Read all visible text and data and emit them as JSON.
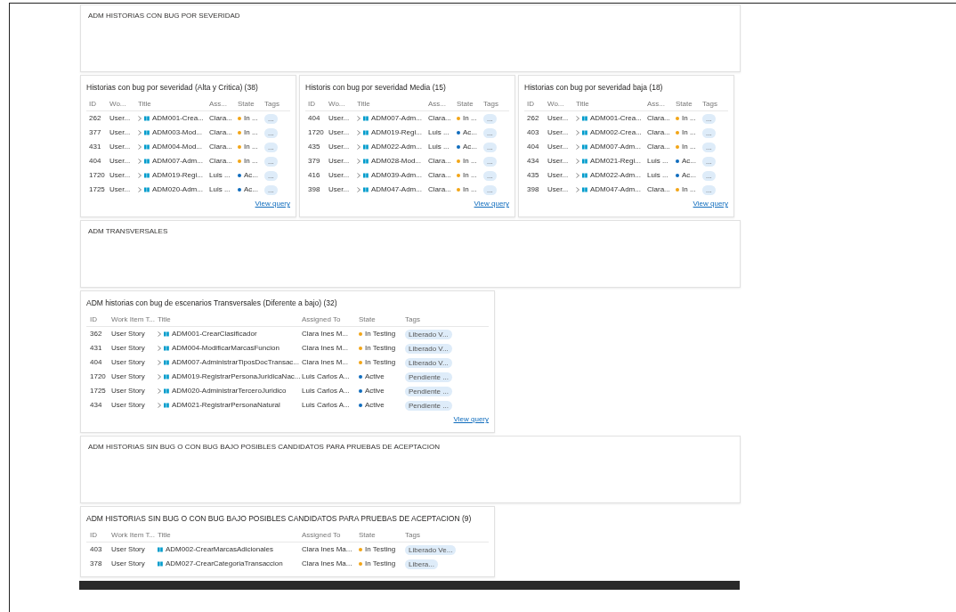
{
  "widgets": [
    {
      "kind": "text",
      "text": "ADM HISTORIAS CON BUG POR SEVERIDAD"
    },
    {
      "kind": "query-small",
      "title": "Historias con bug por severidad (Alta y Critica) (38)",
      "columns": [
        "ID",
        "Wo...",
        "Title",
        "Ass...",
        "State",
        "Tags"
      ],
      "link": "View query",
      "rows": [
        {
          "id": "262",
          "type": "User...",
          "title": "ADM001-Crea...",
          "assigned": "Clara...",
          "state": "In ...",
          "color": "#f2a516",
          "tag": "...",
          "expandable": true
        },
        {
          "id": "377",
          "type": "User...",
          "title": "ADM003-Mod...",
          "assigned": "Clara...",
          "state": "In ...",
          "color": "#f2a516",
          "tag": "...",
          "expandable": true
        },
        {
          "id": "431",
          "type": "User...",
          "title": "ADM004-Mod...",
          "assigned": "Clara...",
          "state": "In ...",
          "color": "#f2a516",
          "tag": "...",
          "expandable": true
        },
        {
          "id": "404",
          "type": "User...",
          "title": "ADM007-Adm...",
          "assigned": "Clara...",
          "state": "In ...",
          "color": "#f2a516",
          "tag": "...",
          "expandable": true
        },
        {
          "id": "1720",
          "type": "User...",
          "title": "ADM019-Regi...",
          "assigned": "Luis ...",
          "state": "Ac...",
          "color": "#0f6cbd",
          "tag": "...",
          "expandable": true
        },
        {
          "id": "1725",
          "type": "User...",
          "title": "ADM020-Adm...",
          "assigned": "Luis ...",
          "state": "Ac...",
          "color": "#0f6cbd",
          "tag": "...",
          "expandable": true
        }
      ]
    },
    {
      "kind": "query-small",
      "title": "Historis con bug por severidad Media (15)",
      "columns": [
        "ID",
        "Wo...",
        "Title",
        "Ass...",
        "State",
        "Tags"
      ],
      "link": "View query",
      "rows": [
        {
          "id": "404",
          "type": "User...",
          "title": "ADM007-Adm...",
          "assigned": "Clara...",
          "state": "In ...",
          "color": "#f2a516",
          "tag": "...",
          "expandable": true
        },
        {
          "id": "1720",
          "type": "User...",
          "title": "ADM019-Regi...",
          "assigned": "Luis ...",
          "state": "Ac...",
          "color": "#0f6cbd",
          "tag": "...",
          "expandable": true
        },
        {
          "id": "435",
          "type": "User...",
          "title": "ADM022-Adm...",
          "assigned": "Luis ...",
          "state": "Ac...",
          "color": "#0f6cbd",
          "tag": "...",
          "expandable": true
        },
        {
          "id": "379",
          "type": "User...",
          "title": "ADM028-Mod...",
          "assigned": "Clara...",
          "state": "In ...",
          "color": "#f2a516",
          "tag": "...",
          "expandable": true
        },
        {
          "id": "416",
          "type": "User...",
          "title": "ADM039-Adm...",
          "assigned": "Clara...",
          "state": "In ...",
          "color": "#f2a516",
          "tag": "...",
          "expandable": true
        },
        {
          "id": "398",
          "type": "User...",
          "title": "ADM047-Adm...",
          "assigned": "Clara...",
          "state": "In ...",
          "color": "#f2a516",
          "tag": "...",
          "expandable": true
        }
      ]
    },
    {
      "kind": "query-small",
      "title": "Historias con bug por severidad baja (18)",
      "columns": [
        "ID",
        "Wo...",
        "Title",
        "Ass...",
        "State",
        "Tags"
      ],
      "link": "View query",
      "rows": [
        {
          "id": "262",
          "type": "User...",
          "title": "ADM001-Crea...",
          "assigned": "Clara...",
          "state": "In ...",
          "color": "#f2a516",
          "tag": "...",
          "expandable": true
        },
        {
          "id": "403",
          "type": "User...",
          "title": "ADM002-Crea...",
          "assigned": "Clara...",
          "state": "In ...",
          "color": "#f2a516",
          "tag": "...",
          "expandable": true
        },
        {
          "id": "404",
          "type": "User...",
          "title": "ADM007-Adm...",
          "assigned": "Clara...",
          "state": "In ...",
          "color": "#f2a516",
          "tag": "...",
          "expandable": true
        },
        {
          "id": "434",
          "type": "User...",
          "title": "ADM021-Regi...",
          "assigned": "Luis ...",
          "state": "Ac...",
          "color": "#0f6cbd",
          "tag": "...",
          "expandable": true
        },
        {
          "id": "435",
          "type": "User...",
          "title": "ADM022-Adm...",
          "assigned": "Luis ...",
          "state": "Ac...",
          "color": "#0f6cbd",
          "tag": "...",
          "expandable": true
        },
        {
          "id": "398",
          "type": "User...",
          "title": "ADM047-Adm...",
          "assigned": "Clara...",
          "state": "In ...",
          "color": "#f2a516",
          "tag": "...",
          "expandable": true
        }
      ]
    },
    {
      "kind": "text",
      "text": "ADM TRANSVERSALES"
    },
    {
      "kind": "query-large",
      "title": "ADM historias con bug de escenarios Transversales (Diferente a bajo) (32)",
      "columns": [
        "ID",
        "Work Item T...",
        "Title",
        "Assigned To",
        "State",
        "Tags"
      ],
      "link": "View query",
      "rows": [
        {
          "id": "362",
          "type": "User Story",
          "title": "ADM001-CrearClasificador",
          "assigned": "Clara Ines M...",
          "state": "In Testing",
          "color": "#f2a516",
          "tag": "Liberado V...",
          "expandable": true
        },
        {
          "id": "431",
          "type": "User Story",
          "title": "ADM004-ModificarMarcasFuncion",
          "assigned": "Clara Ines M...",
          "state": "In Testing",
          "color": "#f2a516",
          "tag": "Liberado V...",
          "expandable": true
        },
        {
          "id": "404",
          "type": "User Story",
          "title": "ADM007-AdministrarTiposDocTransac...",
          "assigned": "Clara Ines M...",
          "state": "In Testing",
          "color": "#f2a516",
          "tag": "Liberado V...",
          "expandable": true
        },
        {
          "id": "1720",
          "type": "User Story",
          "title": "ADM019-RegistrarPersonaJuridicaNac...",
          "assigned": "Luis Carlos A...",
          "state": "Active",
          "color": "#0f6cbd",
          "tag": "Pendiente ...",
          "expandable": true
        },
        {
          "id": "1725",
          "type": "User Story",
          "title": "ADM020-AdministrarTerceroJuridico",
          "assigned": "Luis Carlos A...",
          "state": "Active",
          "color": "#0f6cbd",
          "tag": "Pendiente ...",
          "expandable": true
        },
        {
          "id": "434",
          "type": "User Story",
          "title": "ADM021-RegistrarPersonaNatural",
          "assigned": "Luis Carlos A...",
          "state": "Active",
          "color": "#0f6cbd",
          "tag": "Pendiente ...",
          "expandable": true
        }
      ]
    },
    {
      "kind": "text",
      "text": "ADM HISTORIAS SIN BUG O CON BUG BAJO POSIBLES CANDIDATOS PARA PRUEBAS DE ACEPTACION"
    },
    {
      "kind": "query-large",
      "title": "ADM HISTORIAS SIN BUG O CON BUG BAJO POSIBLES CANDIDATOS PARA PRUEBAS DE ACEPTACION (9)",
      "columns": [
        "ID",
        "Work Item T...",
        "Title",
        "Assigned To",
        "State",
        "Tags"
      ],
      "rows": [
        {
          "id": "403",
          "type": "User Story",
          "title": "ADM002-CrearMarcasAdicionales",
          "assigned": "Clara Ines Ma...",
          "state": "In Testing",
          "color": "#f2a516",
          "tag": "Liberado Ve...",
          "expandable": false
        },
        {
          "id": "378",
          "type": "User Story",
          "title": "ADM027-CrearCategoriaTransaccion",
          "assigned": "Clara Ines Ma...",
          "state": "In Testing",
          "color": "#f2a516",
          "tag": "Libera...",
          "expandable": false
        }
      ]
    }
  ]
}
